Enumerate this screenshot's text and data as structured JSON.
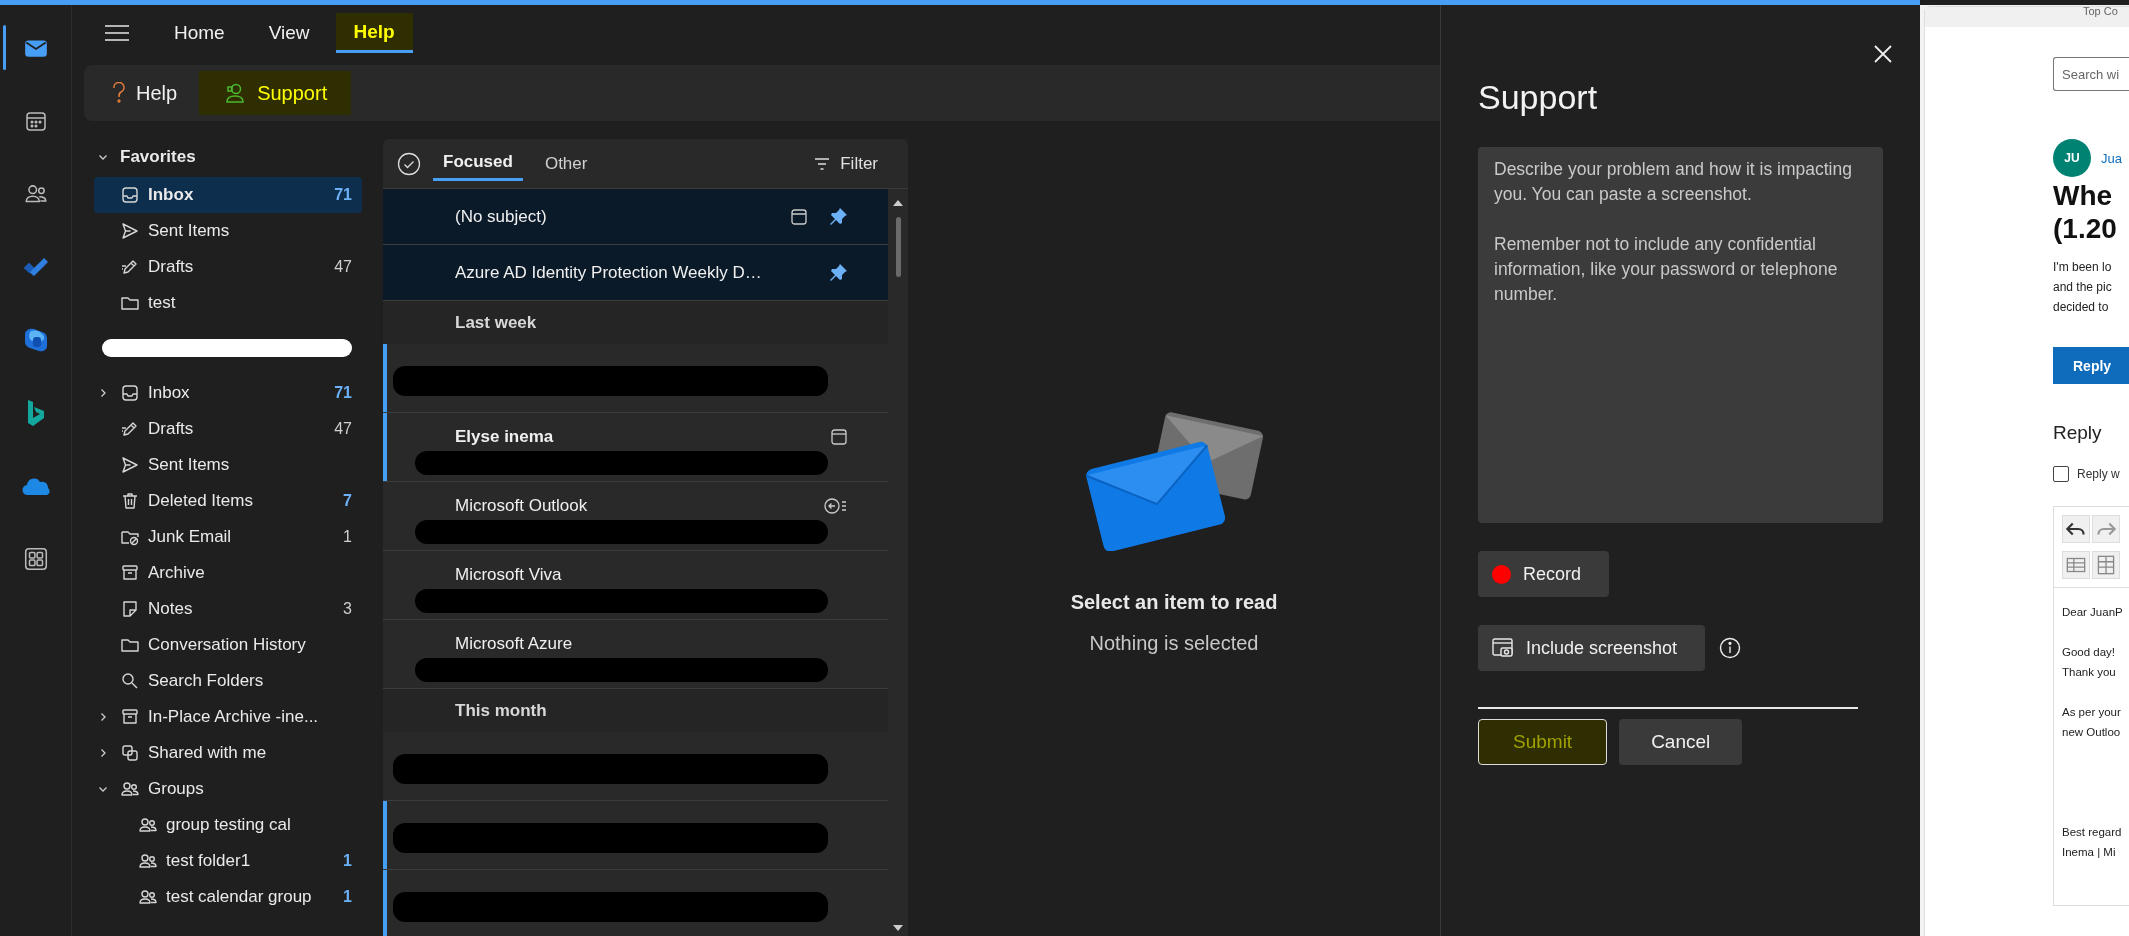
{
  "app_rail": [
    {
      "kind": "mail",
      "selected": true
    },
    {
      "kind": "calendar",
      "selected": false
    },
    {
      "kind": "people",
      "selected": false
    },
    {
      "kind": "todo",
      "selected": false
    },
    {
      "kind": "m365",
      "selected": false
    },
    {
      "kind": "bing",
      "selected": false
    },
    {
      "kind": "onedrive",
      "selected": false
    },
    {
      "kind": "apps",
      "selected": false
    }
  ],
  "tabs": [
    {
      "label": "Home",
      "selected": false,
      "highlighted": false
    },
    {
      "label": "View",
      "selected": false,
      "highlighted": false
    },
    {
      "label": "Help",
      "selected": true,
      "highlighted": true
    }
  ],
  "ribbon": [
    {
      "kind": "help",
      "label": "Help",
      "highlighted": false
    },
    {
      "kind": "support",
      "label": "Support",
      "highlighted": true
    }
  ],
  "folders": {
    "favorites": {
      "label": "Favorites",
      "expanded": true,
      "items": [
        {
          "kind": "inbox",
          "label": "Inbox",
          "count": "71",
          "unread": true,
          "selected": true
        },
        {
          "kind": "sent",
          "label": "Sent Items",
          "selected": false
        },
        {
          "kind": "drafts",
          "label": "Drafts",
          "count": "47",
          "unread": false,
          "selected": false
        },
        {
          "kind": "folder",
          "label": "test",
          "selected": false
        }
      ]
    },
    "account_redacted": true,
    "items": [
      {
        "kind": "inbox",
        "label": "Inbox",
        "count": "71",
        "unread": true,
        "selected": false,
        "expanded": false
      },
      {
        "kind": "drafts",
        "label": "Drafts",
        "count": "47",
        "unread": false,
        "selected": false
      },
      {
        "kind": "sent",
        "label": "Sent Items",
        "selected": false
      },
      {
        "kind": "trash",
        "label": "Deleted Items",
        "count": "7",
        "unread": true,
        "selected": false
      },
      {
        "kind": "junk",
        "label": "Junk Email",
        "count": "1",
        "unread": false,
        "selected": false
      },
      {
        "kind": "archive",
        "label": "Archive",
        "selected": false
      },
      {
        "kind": "note",
        "label": "Notes",
        "count": "3",
        "unread": false,
        "selected": false
      },
      {
        "kind": "folder",
        "label": "Conversation History",
        "selected": false
      },
      {
        "kind": "search",
        "label": "Search Folders",
        "selected": false
      },
      {
        "kind": "archive",
        "label": "In-Place Archive -ine...",
        "selected": false,
        "expanded": false
      },
      {
        "kind": "shared",
        "label": "Shared with me",
        "selected": false,
        "expanded": false
      },
      {
        "kind": "group",
        "label": "Groups",
        "selected": false,
        "expanded": true,
        "children": [
          {
            "kind": "group",
            "label": "group testing cal",
            "selected": false
          },
          {
            "kind": "group",
            "label": "test folder1",
            "count": "1",
            "unread": true,
            "selected": false
          },
          {
            "kind": "group",
            "label": "test calendar group",
            "count": "1",
            "unread": true,
            "selected": false
          }
        ]
      }
    ]
  },
  "message_list": {
    "tabs": [
      {
        "label": "Focused",
        "selected": true
      },
      {
        "label": "Other",
        "selected": false
      }
    ],
    "filter": "Filter",
    "items": [
      {
        "kind": "message",
        "sender": "(No subject)",
        "pinned": true,
        "unread": false,
        "meeting": true,
        "replied": false,
        "redacted": false
      },
      {
        "kind": "message",
        "sender": "Azure AD Identity Protection Weekly D…",
        "pinned": true,
        "unread": false,
        "meeting": false,
        "replied": false,
        "redacted": false
      },
      {
        "kind": "header",
        "label": "Last week"
      },
      {
        "kind": "message",
        "pinned": false,
        "unread": true,
        "meeting": false,
        "replied": false,
        "redacted": true
      },
      {
        "kind": "message",
        "sender": "Elyse inema",
        "pinned": false,
        "unread": true,
        "meeting": true,
        "replied": false,
        "redacted": true
      },
      {
        "kind": "message",
        "sender": "Microsoft Outlook",
        "pinned": false,
        "unread": false,
        "meeting": false,
        "replied": true,
        "redacted": true
      },
      {
        "kind": "message",
        "sender": "Microsoft Viva",
        "pinned": false,
        "unread": false,
        "meeting": false,
        "replied": false,
        "redacted": true
      },
      {
        "kind": "message",
        "sender": "Microsoft Azure",
        "pinned": false,
        "unread": false,
        "meeting": false,
        "replied": false,
        "redacted": true
      },
      {
        "kind": "header",
        "label": "This month"
      },
      {
        "kind": "message",
        "pinned": false,
        "unread": false,
        "meeting": false,
        "replied": false,
        "redacted": true
      },
      {
        "kind": "message",
        "pinned": false,
        "unread": true,
        "meeting": false,
        "replied": false,
        "redacted": true
      },
      {
        "kind": "message",
        "pinned": false,
        "unread": true,
        "meeting": false,
        "replied": false,
        "redacted": true
      }
    ]
  },
  "reading_pane": {
    "title": "Select an item to read",
    "subtitle": "Nothing is selected"
  },
  "support_panel": {
    "title": "Support",
    "placeholder": "Describe your problem and how it is impacting you. You can paste a screenshot.\n\nRemember not to include any confidential information, like your password or telephone number.",
    "buttons": [
      {
        "kind": "record",
        "label": "Record"
      },
      {
        "kind": "screenshot",
        "label": "Include screenshot"
      }
    ],
    "actions": [
      {
        "kind": "primary",
        "label": "Submit",
        "highlighted": true
      },
      {
        "kind": "secondary",
        "label": "Cancel",
        "highlighted": false
      }
    ]
  },
  "browser_page": {
    "top": "Top Co",
    "search_placeholder": "Search wi",
    "avatar": "JU",
    "author": "Jua",
    "title_lines": [
      "Whe",
      "(1.20"
    ],
    "paragraph_lines": [
      "I'm been lo",
      "and the pic",
      "decided to"
    ],
    "reply_button": "Reply",
    "reply_heading": "Reply",
    "checkbox": {
      "label": "Reply w",
      "checked": false
    },
    "editor_paragraphs": [
      {
        "kind": "body",
        "lines": [
          "Dear JuanP"
        ]
      },
      {
        "kind": "body",
        "lines": [
          "Good day!",
          "Thank you"
        ]
      },
      {
        "kind": "body",
        "lines": [
          "As per your",
          "new Outloo"
        ]
      },
      {
        "kind": "signature",
        "lines": [
          "Best regard",
          "Inema | Mi"
        ]
      }
    ]
  }
}
